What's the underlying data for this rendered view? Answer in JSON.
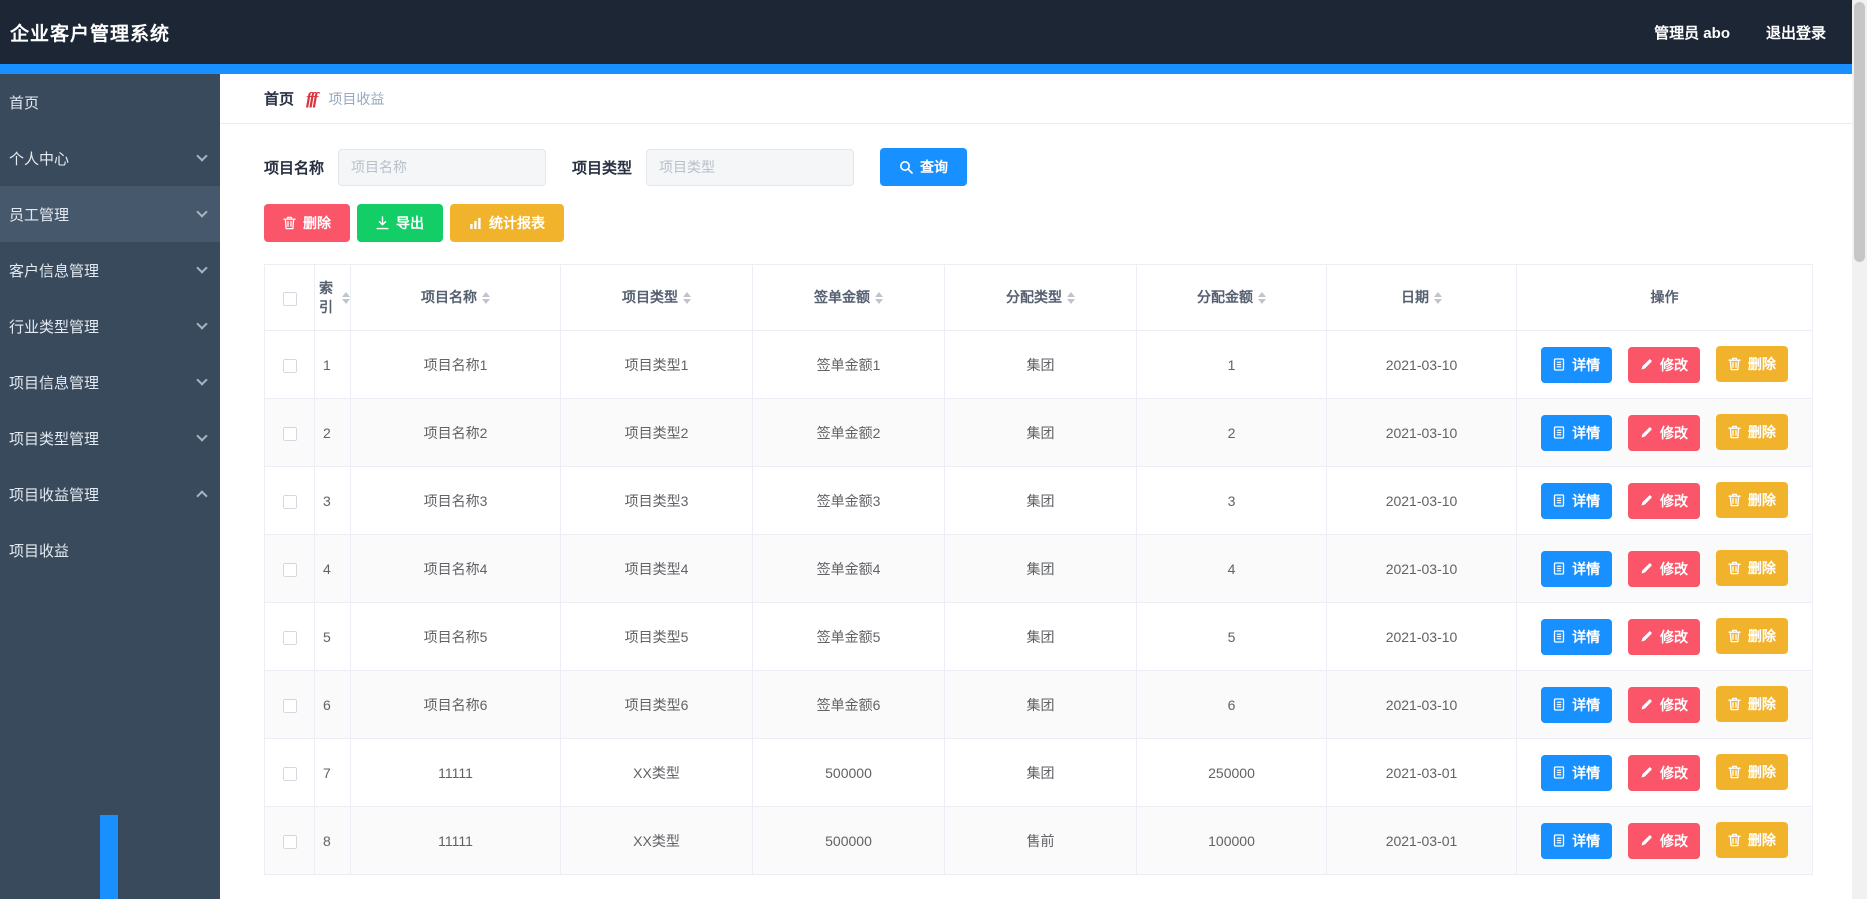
{
  "colors": {
    "primary": "#1890ff",
    "danger": "#fa5568",
    "success": "#13ce66",
    "warning": "#f2b32c",
    "header-bg": "#1d2635",
    "sidebar-bg": "#394a5d",
    "sidebar-highlight": "#46586c",
    "table-border": "#ebeef5",
    "zebra": "#fafafa"
  },
  "header": {
    "title": "企业客户管理系统",
    "user": "管理员 abo",
    "logout": "退出登录"
  },
  "sidebar": {
    "items": [
      {
        "label": "首页",
        "expandable": false
      },
      {
        "label": "个人中心",
        "expandable": true,
        "state": "collapsed"
      },
      {
        "label": "员工管理",
        "expandable": true,
        "state": "collapsed",
        "highlighted": true
      },
      {
        "label": "客户信息管理",
        "expandable": true,
        "state": "collapsed"
      },
      {
        "label": "行业类型管理",
        "expandable": true,
        "state": "collapsed"
      },
      {
        "label": "项目信息管理",
        "expandable": true,
        "state": "collapsed"
      },
      {
        "label": "项目类型管理",
        "expandable": true,
        "state": "collapsed"
      },
      {
        "label": "项目收益管理",
        "expandable": true,
        "state": "expanded"
      },
      {
        "label": "项目收益",
        "expandable": false,
        "submenu": true,
        "active": true
      }
    ]
  },
  "breadcrumb": {
    "home": "首页",
    "separator_icon": "fff",
    "current": "项目收益"
  },
  "search": {
    "name_label": "项目名称",
    "name_placeholder": "项目名称",
    "type_label": "项目类型",
    "type_placeholder": "项目类型",
    "query_button": "查询"
  },
  "actions": {
    "delete": "删除",
    "export": "导出",
    "report": "统计报表"
  },
  "icons": {
    "query": "search-icon",
    "delete": "trash-icon",
    "export": "download-icon",
    "report": "bar-chart-icon",
    "detail": "document-icon",
    "edit": "pen-icon",
    "row_delete": "trash-icon"
  },
  "table": {
    "columns": [
      "索引",
      "项目名称",
      "项目类型",
      "签单金额",
      "分配类型",
      "分配金额",
      "日期",
      "操作"
    ],
    "sortable_columns": [
      "索引",
      "项目名称",
      "项目类型",
      "签单金额",
      "分配类型",
      "分配金额",
      "日期"
    ],
    "row_actions": {
      "detail": "详情",
      "edit": "修改",
      "delete": "删除"
    },
    "rows": [
      {
        "index": "1",
        "name": "项目名称1",
        "type": "项目类型1",
        "amount": "签单金额1",
        "alloc_type": "集团",
        "alloc_amount": "1",
        "date": "2021-03-10"
      },
      {
        "index": "2",
        "name": "项目名称2",
        "type": "项目类型2",
        "amount": "签单金额2",
        "alloc_type": "集团",
        "alloc_amount": "2",
        "date": "2021-03-10"
      },
      {
        "index": "3",
        "name": "项目名称3",
        "type": "项目类型3",
        "amount": "签单金额3",
        "alloc_type": "集团",
        "alloc_amount": "3",
        "date": "2021-03-10"
      },
      {
        "index": "4",
        "name": "项目名称4",
        "type": "项目类型4",
        "amount": "签单金额4",
        "alloc_type": "集团",
        "alloc_amount": "4",
        "date": "2021-03-10"
      },
      {
        "index": "5",
        "name": "项目名称5",
        "type": "项目类型5",
        "amount": "签单金额5",
        "alloc_type": "集团",
        "alloc_amount": "5",
        "date": "2021-03-10"
      },
      {
        "index": "6",
        "name": "项目名称6",
        "type": "项目类型6",
        "amount": "签单金额6",
        "alloc_type": "集团",
        "alloc_amount": "6",
        "date": "2021-03-10"
      },
      {
        "index": "7",
        "name": "11111",
        "type": "XX类型",
        "amount": "500000",
        "alloc_type": "集团",
        "alloc_amount": "250000",
        "date": "2021-03-01"
      },
      {
        "index": "8",
        "name": "11111",
        "type": "XX类型",
        "amount": "500000",
        "alloc_type": "售前",
        "alloc_amount": "100000",
        "date": "2021-03-01"
      }
    ]
  }
}
